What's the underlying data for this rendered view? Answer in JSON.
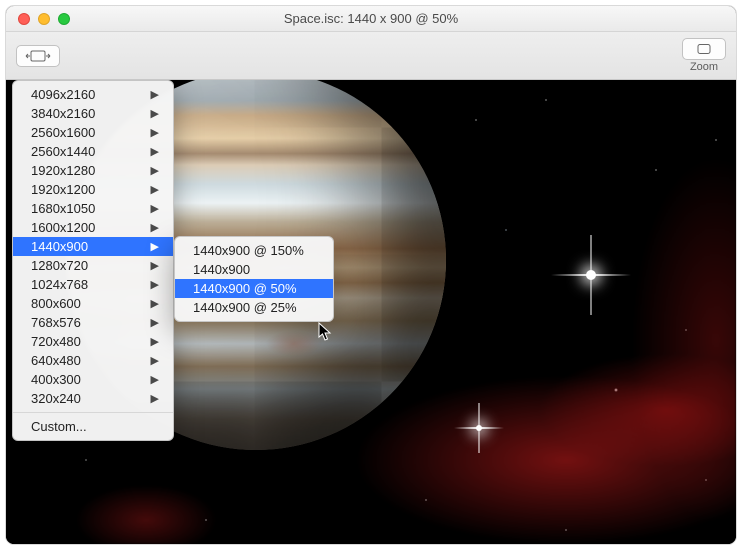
{
  "title": "Space.isc: 1440 x 900 @ 50%",
  "toolbar": {
    "zoom_label": "Zoom"
  },
  "menu": {
    "items": [
      {
        "label": "4096x2160",
        "submenu": true,
        "selected": false
      },
      {
        "label": "3840x2160",
        "submenu": true,
        "selected": false
      },
      {
        "label": "2560x1600",
        "submenu": true,
        "selected": false
      },
      {
        "label": "2560x1440",
        "submenu": true,
        "selected": false
      },
      {
        "label": "1920x1280",
        "submenu": true,
        "selected": false
      },
      {
        "label": "1920x1200",
        "submenu": true,
        "selected": false
      },
      {
        "label": "1680x1050",
        "submenu": true,
        "selected": false
      },
      {
        "label": "1600x1200",
        "submenu": true,
        "selected": false
      },
      {
        "label": "1440x900",
        "submenu": true,
        "selected": true
      },
      {
        "label": "1280x720",
        "submenu": true,
        "selected": false
      },
      {
        "label": "1024x768",
        "submenu": true,
        "selected": false
      },
      {
        "label": "800x600",
        "submenu": true,
        "selected": false
      },
      {
        "label": "768x576",
        "submenu": true,
        "selected": false
      },
      {
        "label": "720x480",
        "submenu": true,
        "selected": false
      },
      {
        "label": "640x480",
        "submenu": true,
        "selected": false
      },
      {
        "label": "400x300",
        "submenu": true,
        "selected": false
      },
      {
        "label": "320x240",
        "submenu": true,
        "selected": false
      }
    ],
    "custom_label": "Custom..."
  },
  "submenu": {
    "items": [
      {
        "label": "1440x900 @ 150%",
        "selected": false
      },
      {
        "label": "1440x900",
        "selected": false
      },
      {
        "label": "1440x900 @ 50%",
        "selected": true
      },
      {
        "label": "1440x900 @ 25%",
        "selected": false
      }
    ]
  }
}
